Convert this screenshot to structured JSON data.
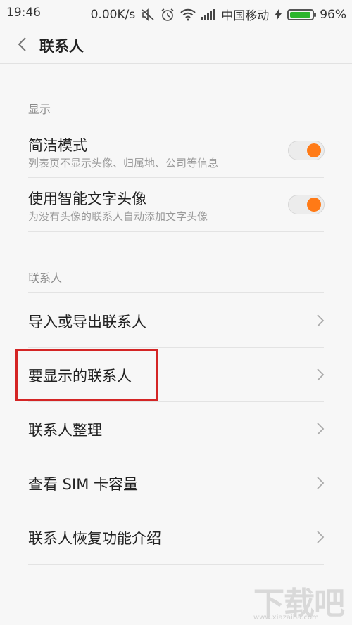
{
  "status_bar": {
    "time": "19:46",
    "speed": "0.00K/s",
    "carrier": "中国移动",
    "battery": "96%",
    "battery_level": 0.96,
    "icons": [
      "mute-icon",
      "alarm-icon",
      "wifi-icon",
      "signal-icon",
      "charging-icon",
      "battery-icon"
    ]
  },
  "header": {
    "title": "联系人",
    "back_icon": "back-chevron-icon"
  },
  "sections": {
    "display": {
      "label": "显示",
      "items": [
        {
          "title": "简洁模式",
          "subtitle": "列表页不显示头像、归属地、公司等信息",
          "enabled": true
        },
        {
          "title": "使用智能文字头像",
          "subtitle": "为没有头像的联系人自动添加文字头像",
          "enabled": true
        }
      ]
    },
    "contacts": {
      "label": "联系人",
      "items": [
        {
          "label": "导入或导出联系人"
        },
        {
          "label": "要显示的联系人"
        },
        {
          "label": "联系人整理"
        },
        {
          "label": "查看 SIM 卡容量"
        },
        {
          "label": "联系人恢复功能介绍"
        }
      ]
    }
  },
  "colors": {
    "accent": "#ff7a16",
    "highlight": "#d42525",
    "battery": "#2db52d"
  },
  "watermark": {
    "text": "下载吧",
    "sub": "www.xiazaiba.com"
  }
}
